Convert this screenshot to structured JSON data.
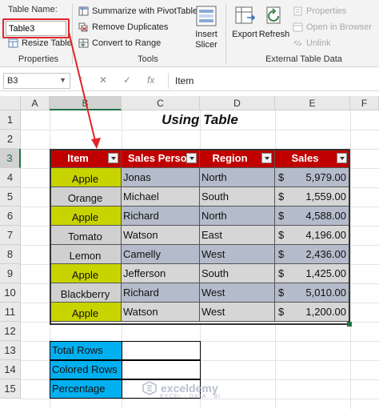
{
  "ribbon": {
    "properties": {
      "table_name_label": "Table Name:",
      "table_name_value": "Table3",
      "resize_label": "Resize Table",
      "group_label": "Properties"
    },
    "tools": {
      "pivot_label": "Summarize with PivotTable",
      "remove_dup_label": "Remove Duplicates",
      "convert_label": "Convert to Range",
      "insert_slicer_label": "Insert\nSlicer",
      "group_label": "Tools"
    },
    "external": {
      "export_label": "Export",
      "refresh_label": "Refresh",
      "properties_label": "Properties",
      "open_browser_label": "Open in Browser",
      "unlink_label": "Unlink",
      "group_label": "External Table Data"
    }
  },
  "formula_bar": {
    "name_box": "B3",
    "cancel_symbol": "✕",
    "enter_symbol": "✓",
    "fx_symbol": "fx",
    "content": "Item"
  },
  "columns": [
    "A",
    "B",
    "C",
    "D",
    "E",
    "F"
  ],
  "rows": [
    "1",
    "2",
    "3",
    "4",
    "5",
    "6",
    "7",
    "8",
    "9",
    "10",
    "11",
    "12",
    "13",
    "14",
    "15"
  ],
  "sheet": {
    "title": "Using Table",
    "headers": [
      "Item",
      "Sales Person",
      "Region",
      "Sales"
    ],
    "currency_symbol": "$",
    "records": [
      {
        "item": "Apple",
        "person": "Jonas",
        "region": "North",
        "sales": "5,979.00"
      },
      {
        "item": "Orange",
        "person": "Michael",
        "region": "South",
        "sales": "1,559.00"
      },
      {
        "item": "Apple",
        "person": "Richard",
        "region": "North",
        "sales": "4,588.00"
      },
      {
        "item": "Tomato",
        "person": "Watson",
        "region": "East",
        "sales": "4,196.00"
      },
      {
        "item": "Lemon",
        "person": "Camelly",
        "region": "West",
        "sales": "2,436.00"
      },
      {
        "item": "Apple",
        "person": "Jefferson",
        "region": "South",
        "sales": "1,425.00"
      },
      {
        "item": "Blackberry",
        "person": "Richard",
        "region": "West",
        "sales": "5,010.00"
      },
      {
        "item": "Apple",
        "person": "Watson",
        "region": "West",
        "sales": "1,200.00"
      }
    ],
    "summary": [
      {
        "label": "Total Rows",
        "value": ""
      },
      {
        "label": "Colored Rows",
        "value": ""
      },
      {
        "label": "Percentage",
        "value": ""
      }
    ]
  },
  "colors": {
    "header_red": "#c00000",
    "apple_yellow": "#c8d400",
    "item_gray": "#d0d0d0",
    "row_odd": "#b4bccb",
    "row_even": "#d6d6d6",
    "summary_blue": "#00b0f0",
    "callout_red": "#e0262a"
  },
  "watermark": {
    "brand": "exceldemy",
    "tagline": "EXCEL · DATA · BI"
  }
}
